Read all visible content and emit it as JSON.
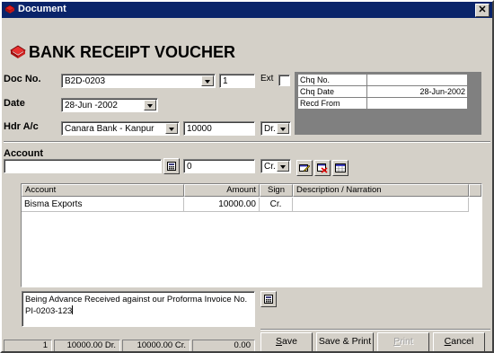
{
  "window": {
    "title": "Document",
    "close_glyph": "✕"
  },
  "heading": "BANK RECEIPT VOUCHER",
  "labels": {
    "doc_no": "Doc No.",
    "date": "Date",
    "hdr_ac": "Hdr A/c",
    "ext": "Ext",
    "account": "Account"
  },
  "fields": {
    "doc_no": "B2D-0203",
    "doc_seq": "1",
    "date": "28-Jun -2002",
    "hdr_account": "Canara Bank -  Kanpur",
    "hdr_amount": "10000",
    "hdr_sign": "Dr.",
    "account": "",
    "account_amount": "0",
    "account_sign": "Cr."
  },
  "cheque": {
    "rows": [
      {
        "label": "Chq No.",
        "value": ""
      },
      {
        "label": "Chq Date",
        "value": "28-Jun-2002"
      },
      {
        "label": "Recd From",
        "value": ""
      }
    ]
  },
  "grid": {
    "columns": [
      "Account",
      "Amount",
      "Sign",
      "Description / Narration"
    ],
    "rows": [
      {
        "account": "Bisma Exports",
        "amount": "10000.00",
        "sign": "Cr.",
        "narration": ""
      }
    ]
  },
  "narration": {
    "line1": "Being Advance Received against our Proforma Invoice No.",
    "line2": "PI-0203-123"
  },
  "status": {
    "count": "1",
    "debit": "10000.00 Dr.",
    "credit": "10000.00 Cr.",
    "balance": "0.00"
  },
  "buttons": {
    "save": {
      "pre": "",
      "u": "S",
      "post": "ave"
    },
    "save_print": {
      "label": "Save & Print"
    },
    "print": {
      "pre": "",
      "u": "P",
      "post": "rint"
    },
    "cancel": {
      "pre": "",
      "u": "C",
      "post": "ancel"
    }
  },
  "colors": {
    "titlebar": "#0a246a",
    "face": "#d4d0c8",
    "icon_red": "#d42020"
  }
}
